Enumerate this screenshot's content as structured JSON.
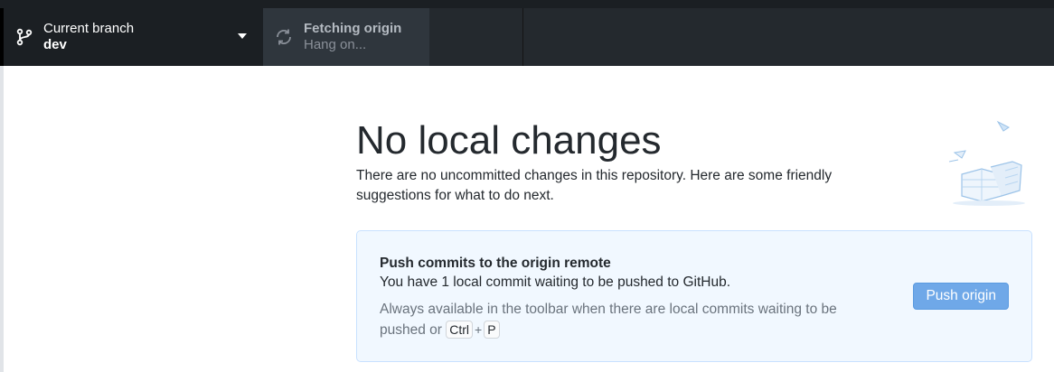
{
  "toolbar": {
    "branch": {
      "title": "Current branch",
      "name": "dev",
      "icon": "git-branch-icon"
    },
    "fetch": {
      "title": "Fetching origin",
      "status": "Hang on...",
      "icon": "sync-icon"
    }
  },
  "main": {
    "heading": "No local changes",
    "description": "There are no uncommitted changes in this repository. Here are some friendly suggestions for what to do next.",
    "card": {
      "title": "Push commits to the origin remote",
      "text": "You have 1 local commit waiting to be pushed to GitHub.",
      "hint": "Always available in the toolbar when there are local commits waiting to be pushed or",
      "shortcut_key1": "Ctrl",
      "shortcut_plus": "+",
      "shortcut_key2": "P",
      "button_label": "Push origin"
    }
  },
  "colors": {
    "toolbar_bg": "#24292e",
    "card_bg": "#f1f8ff",
    "button_bg": "#6fa8e8"
  }
}
